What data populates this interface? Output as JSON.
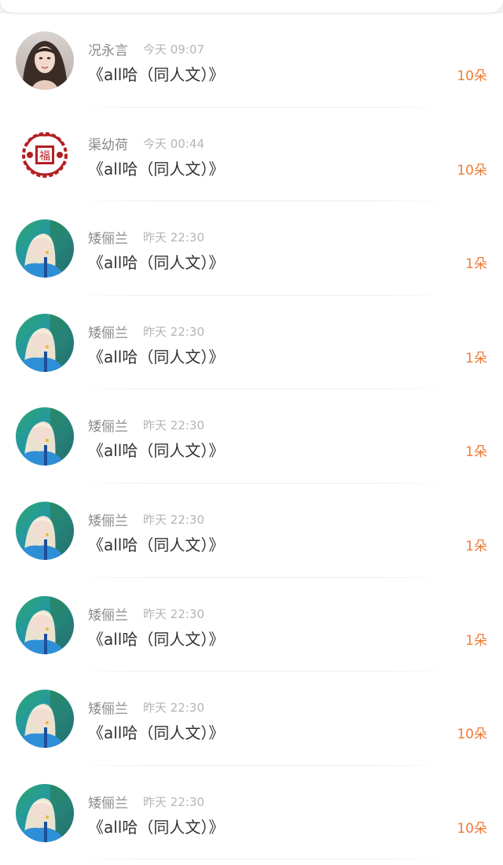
{
  "colors": {
    "name": "#8a8a8a",
    "time": "#b5b5b5",
    "title": "#333333",
    "count_accent": "#f07a35",
    "divider": "#ececec"
  },
  "gifts": [
    {
      "avatar": "portrait-photo",
      "name": "况永言",
      "time": "今天 09:07",
      "title": "《all哈（同人文）》",
      "count": "10朵"
    },
    {
      "avatar": "fu-papercut",
      "name": "渠幼荷",
      "time": "今天 00:44",
      "title": "《all哈（同人文）》",
      "count": "10朵"
    },
    {
      "avatar": "blonde-girl-photo",
      "name": "矮俪兰",
      "time": "昨天 22:30",
      "title": "《all哈（同人文）》",
      "count": "1朵"
    },
    {
      "avatar": "blonde-girl-photo",
      "name": "矮俪兰",
      "time": "昨天 22:30",
      "title": "《all哈（同人文）》",
      "count": "1朵"
    },
    {
      "avatar": "blonde-girl-photo",
      "name": "矮俪兰",
      "time": "昨天 22:30",
      "title": "《all哈（同人文）》",
      "count": "1朵"
    },
    {
      "avatar": "blonde-girl-photo",
      "name": "矮俪兰",
      "time": "昨天 22:30",
      "title": "《all哈（同人文）》",
      "count": "1朵"
    },
    {
      "avatar": "blonde-girl-photo",
      "name": "矮俪兰",
      "time": "昨天 22:30",
      "title": "《all哈（同人文）》",
      "count": "1朵"
    },
    {
      "avatar": "blonde-girl-photo",
      "name": "矮俪兰",
      "time": "昨天 22:30",
      "title": "《all哈（同人文）》",
      "count": "10朵"
    },
    {
      "avatar": "blonde-girl-photo",
      "name": "矮俪兰",
      "time": "昨天 22:30",
      "title": "《all哈（同人文）》",
      "count": "10朵"
    }
  ]
}
